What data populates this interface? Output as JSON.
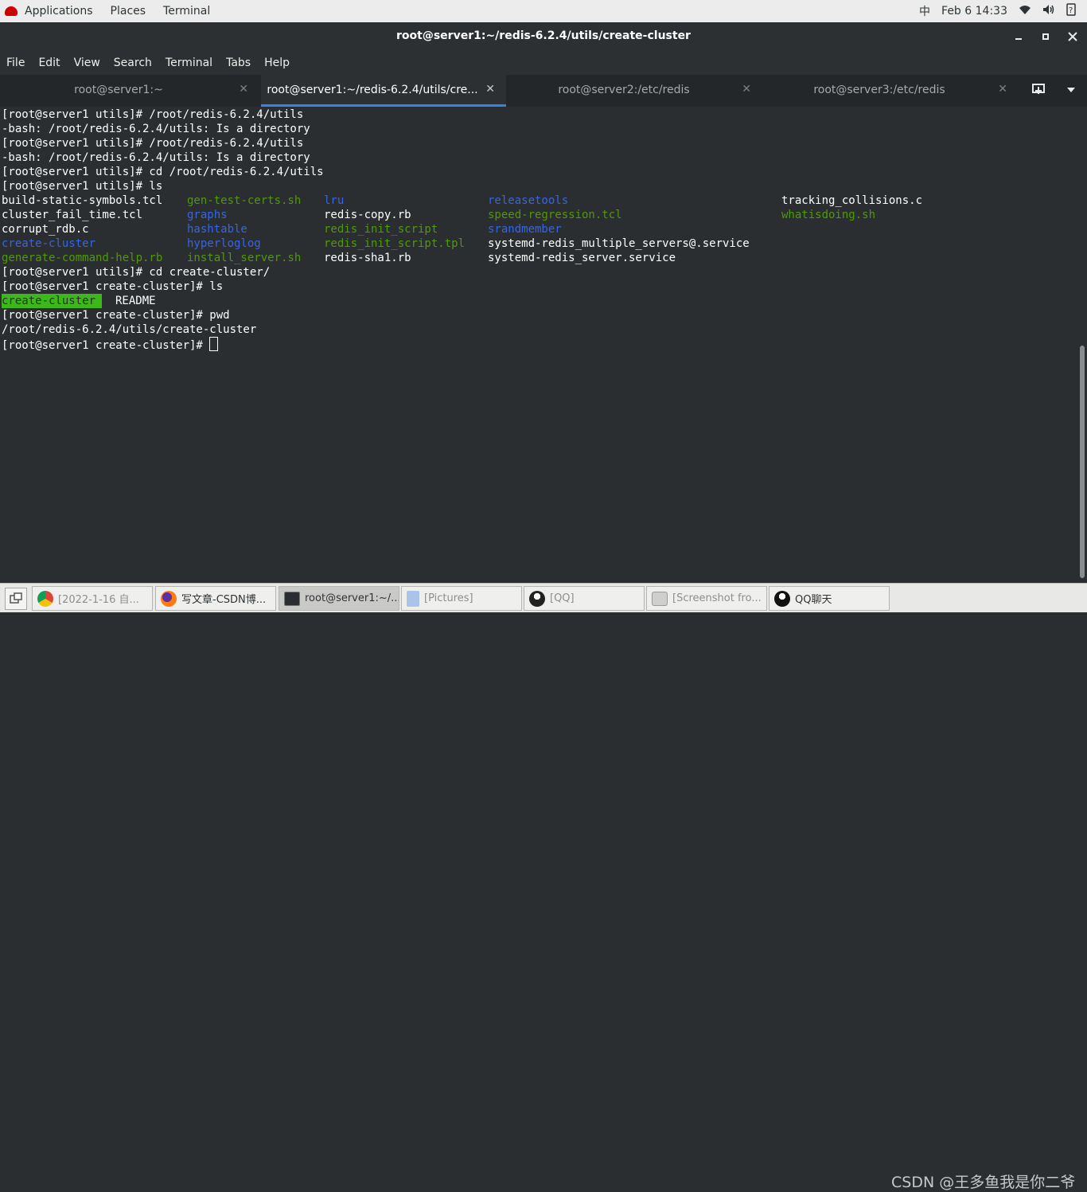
{
  "topbar": {
    "menus": [
      "Applications",
      "Places",
      "Terminal"
    ],
    "input_method": "中",
    "date": "Feb 6",
    "time": "14:33"
  },
  "window": {
    "title": "root@server1:~/redis-6.2.4/utils/create-cluster"
  },
  "menubar": [
    "File",
    "Edit",
    "View",
    "Search",
    "Terminal",
    "Tabs",
    "Help"
  ],
  "tabs": [
    {
      "label": "root@server1:~"
    },
    {
      "label": "root@server1:~/redis-6.2.4/utils/cre..."
    },
    {
      "label": "root@server2:/etc/redis"
    },
    {
      "label": "root@server3:/etc/redis"
    }
  ],
  "terminal": {
    "lines": [
      "[root@server1 utils]# /root/redis-6.2.4/utils",
      "-bash: /root/redis-6.2.4/utils: Is a directory",
      "[root@server1 utils]# /root/redis-6.2.4/utils",
      "-bash: /root/redis-6.2.4/utils: Is a directory",
      "[root@server1 utils]# cd /root/redis-6.2.4/utils",
      "[root@server1 utils]# ls"
    ],
    "ls_rows": [
      [
        "build-static-symbols.tcl",
        "gen-test-certs.sh",
        "lru",
        "releasetools",
        "tracking_collisions.c"
      ],
      [
        "cluster_fail_time.tcl",
        "graphs",
        "redis-copy.rb",
        "speed-regression.tcl",
        "whatisdoing.sh"
      ],
      [
        "corrupt_rdb.c",
        "hashtable",
        "redis_init_script",
        "srandmember",
        ""
      ],
      [
        "create-cluster",
        "hyperloglog",
        "redis_init_script.tpl",
        "systemd-redis_multiple_servers@.service",
        ""
      ],
      [
        "generate-command-help.rb",
        "install_server.sh",
        "redis-sha1.rb",
        "systemd-redis_server.service",
        ""
      ]
    ],
    "lines2": [
      "[root@server1 utils]# cd create-cluster/",
      "[root@server1 create-cluster]# ls"
    ],
    "ls2": [
      "create-cluster",
      "README"
    ],
    "lines3": [
      "[root@server1 create-cluster]# pwd",
      "/root/redis-6.2.4/utils/create-cluster"
    ],
    "prompt": "[root@server1 create-cluster]# "
  },
  "taskbar": {
    "tasks": [
      {
        "label": "[2022-1-16 自...",
        "icon": "chrome-icon"
      },
      {
        "label": "写文章-CSDN博...",
        "icon": "firefox-icon"
      },
      {
        "label": "root@server1:~/...",
        "icon": "terminal-icon"
      },
      {
        "label": "[Pictures]",
        "icon": "file-manager-icon"
      },
      {
        "label": "[QQ]",
        "icon": "qq-icon"
      },
      {
        "label": "[Screenshot fro...",
        "icon": "screenshot-icon"
      },
      {
        "label": "QQ聊天",
        "icon": "qq-icon"
      }
    ],
    "watermark": "CSDN @王多鱼我是你二爷"
  },
  "colors": {
    "terminal_bg": "#2b2e31",
    "dir_blue": "#3465e4",
    "exec_green": "#4e9a06",
    "highlight_green": "#3db819",
    "active_tab_underline": "#3584e4"
  }
}
